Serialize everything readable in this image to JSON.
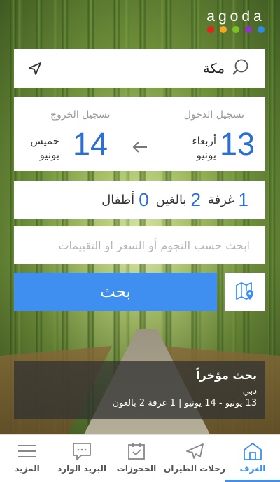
{
  "brand": {
    "name": "agoda",
    "dot_colors": [
      "#e0261c",
      "#f5a623",
      "#7fbf2a",
      "#8e36c4",
      "#2b8de0"
    ]
  },
  "search": {
    "city": "مكة"
  },
  "checkin": {
    "label": "تسجيل الدخول",
    "day": "13",
    "weekday": "أربعاء",
    "month": "يونيو"
  },
  "checkout": {
    "label": "تسجيل الخروج",
    "day": "14",
    "weekday": "خميس",
    "month": "يونيو"
  },
  "guests": {
    "rooms": "1",
    "rooms_label": "غرفة",
    "adults": "2",
    "adults_label": "بالغين",
    "children": "0",
    "children_label": "أطفال"
  },
  "filter": {
    "placeholder": "ابحث حسب النجوم أو السعر او التقييمات"
  },
  "search_button": {
    "label": "بحث"
  },
  "recent": {
    "title": "بحث مؤخراً",
    "city": "دبي",
    "details": "13 يونيو - 14 يونيو | 1 غرفة 2 بالغون"
  },
  "nav": {
    "items": [
      {
        "label": "المزيد",
        "icon": "menu-icon"
      },
      {
        "label": "البريد الوارد",
        "icon": "chat-icon"
      },
      {
        "label": "الحجوزات",
        "icon": "calendar-check-icon"
      },
      {
        "label": "رحلات الطيران",
        "icon": "plane-icon"
      },
      {
        "label": "الغرف",
        "icon": "building-icon",
        "active": true
      }
    ]
  },
  "colors": {
    "accent": "#3e8ff0",
    "date_blue": "#2b6fd4"
  }
}
